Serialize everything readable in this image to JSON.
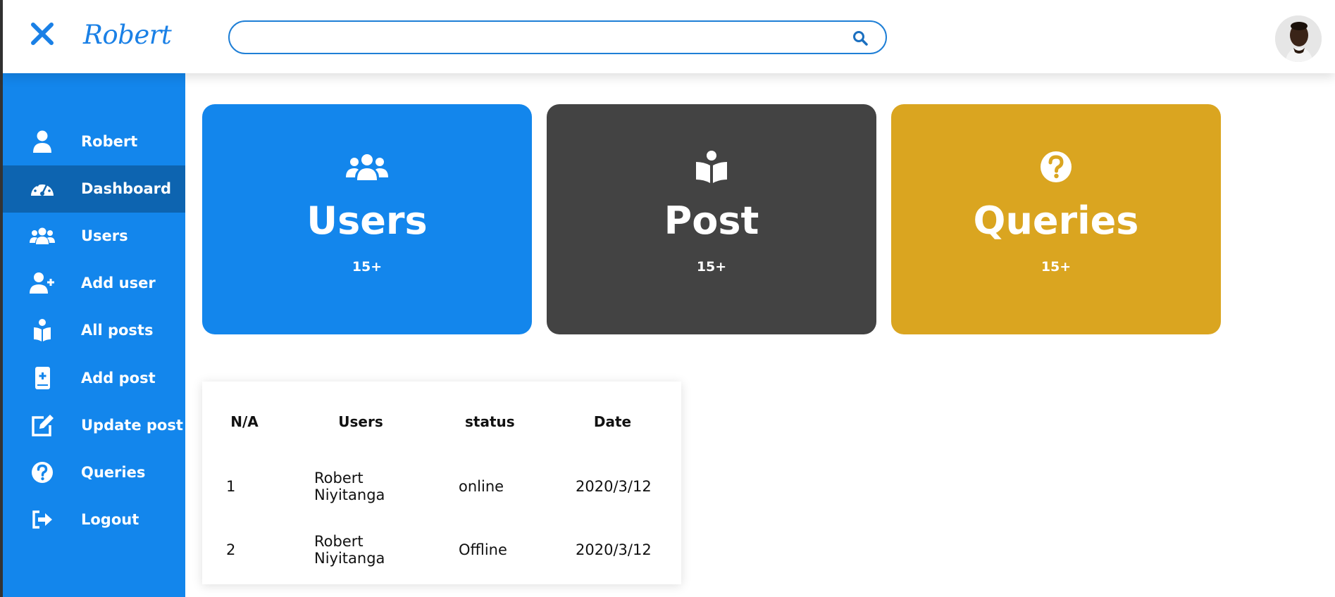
{
  "header": {
    "brand": "Robert",
    "search": {
      "value": "",
      "placeholder": ""
    }
  },
  "sidebar": {
    "items": [
      {
        "label": "Robert",
        "icon": "user-icon"
      },
      {
        "label": "Dashboard",
        "icon": "dashboard-icon",
        "active": true
      },
      {
        "label": "Users",
        "icon": "users-icon"
      },
      {
        "label": "Add user",
        "icon": "user-plus-icon"
      },
      {
        "label": "All posts",
        "icon": "book-reader-icon"
      },
      {
        "label": "Add post",
        "icon": "book-plus-icon"
      },
      {
        "label": "Update post",
        "icon": "edit-icon"
      },
      {
        "label": "Queries",
        "icon": "question-circle-icon"
      },
      {
        "label": "Logout",
        "icon": "logout-icon"
      }
    ]
  },
  "cards": [
    {
      "title": "Users",
      "count": "15+",
      "color": "#1386ec",
      "icon": "users-icon"
    },
    {
      "title": "Post",
      "count": "15+",
      "color": "#434343",
      "icon": "book-reader-icon"
    },
    {
      "title": "Queries",
      "count": "15+",
      "color": "#daa520",
      "icon": "question-circle-icon"
    }
  ],
  "table": {
    "headers": [
      "N/A",
      "Users",
      "status",
      "Date"
    ],
    "rows": [
      [
        "1",
        "Robert Niyitanga",
        "online",
        "2020/3/12"
      ],
      [
        "2",
        "Robert Niyitanga",
        "Offline",
        "2020/3/12"
      ]
    ]
  },
  "colors": {
    "accent": "#1386ec",
    "sidebar_active": "#0d64b0"
  }
}
